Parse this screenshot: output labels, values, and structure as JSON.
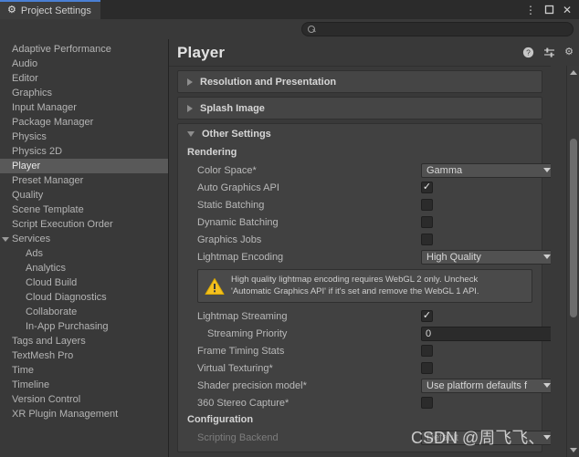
{
  "window": {
    "tab_label": "Project Settings",
    "tab_icon": "gear-icon",
    "controls": {
      "menu": "⋮",
      "maximize": "maximize-icon",
      "close": "✕"
    },
    "accent_color": "#4a7fd4"
  },
  "search": {
    "value": "",
    "placeholder": "",
    "icon": "search-icon"
  },
  "sidebar": {
    "items": [
      {
        "label": "Adaptive Performance",
        "level": 0,
        "selected": false,
        "expandable": false
      },
      {
        "label": "Audio",
        "level": 0,
        "selected": false,
        "expandable": false
      },
      {
        "label": "Editor",
        "level": 0,
        "selected": false,
        "expandable": false
      },
      {
        "label": "Graphics",
        "level": 0,
        "selected": false,
        "expandable": false
      },
      {
        "label": "Input Manager",
        "level": 0,
        "selected": false,
        "expandable": false
      },
      {
        "label": "Package Manager",
        "level": 0,
        "selected": false,
        "expandable": false
      },
      {
        "label": "Physics",
        "level": 0,
        "selected": false,
        "expandable": false
      },
      {
        "label": "Physics 2D",
        "level": 0,
        "selected": false,
        "expandable": false
      },
      {
        "label": "Player",
        "level": 0,
        "selected": true,
        "expandable": false
      },
      {
        "label": "Preset Manager",
        "level": 0,
        "selected": false,
        "expandable": false
      },
      {
        "label": "Quality",
        "level": 0,
        "selected": false,
        "expandable": false
      },
      {
        "label": "Scene Template",
        "level": 0,
        "selected": false,
        "expandable": false
      },
      {
        "label": "Script Execution Order",
        "level": 0,
        "selected": false,
        "expandable": false
      },
      {
        "label": "Services",
        "level": 0,
        "selected": false,
        "expandable": true
      },
      {
        "label": "Ads",
        "level": 1,
        "selected": false,
        "expandable": false
      },
      {
        "label": "Analytics",
        "level": 1,
        "selected": false,
        "expandable": false
      },
      {
        "label": "Cloud Build",
        "level": 1,
        "selected": false,
        "expandable": false
      },
      {
        "label": "Cloud Diagnostics",
        "level": 1,
        "selected": false,
        "expandable": false
      },
      {
        "label": "Collaborate",
        "level": 1,
        "selected": false,
        "expandable": false
      },
      {
        "label": "In-App Purchasing",
        "level": 1,
        "selected": false,
        "expandable": false
      },
      {
        "label": "Tags and Layers",
        "level": 0,
        "selected": false,
        "expandable": false
      },
      {
        "label": "TextMesh Pro",
        "level": 0,
        "selected": false,
        "expandable": false
      },
      {
        "label": "Time",
        "level": 0,
        "selected": false,
        "expandable": false
      },
      {
        "label": "Timeline",
        "level": 0,
        "selected": false,
        "expandable": false
      },
      {
        "label": "Version Control",
        "level": 0,
        "selected": false,
        "expandable": false
      },
      {
        "label": "XR Plugin Management",
        "level": 0,
        "selected": false,
        "expandable": false
      }
    ]
  },
  "main": {
    "title": "Player",
    "header_icons": [
      "help-icon",
      "preset-icon",
      "gear-icon"
    ],
    "foldouts": [
      {
        "label": "Resolution and Presentation",
        "expanded": false
      },
      {
        "label": "Splash Image",
        "expanded": false
      },
      {
        "label": "Other Settings",
        "expanded": true
      }
    ],
    "other_settings": {
      "rendering_label": "Rendering",
      "rows": [
        {
          "label": "Color Space*",
          "type": "dropdown",
          "value": "Gamma",
          "indent": 0,
          "disabled": false
        },
        {
          "label": "Auto Graphics API",
          "type": "checkbox",
          "value": true,
          "indent": 0,
          "disabled": false
        },
        {
          "label": "Static Batching",
          "type": "checkbox",
          "value": false,
          "indent": 0,
          "disabled": false
        },
        {
          "label": "Dynamic Batching",
          "type": "checkbox",
          "value": false,
          "indent": 0,
          "disabled": false
        },
        {
          "label": "Graphics Jobs",
          "type": "checkbox",
          "value": false,
          "indent": 0,
          "disabled": false
        },
        {
          "label": "Lightmap Encoding",
          "type": "dropdown",
          "value": "High Quality",
          "indent": 0,
          "disabled": false
        }
      ],
      "warning": {
        "icon": "warning-icon",
        "line1": "High quality lightmap encoding requires WebGL 2 only. Uncheck",
        "line2": "'Automatic Graphics API' if it's set and remove the WebGL 1 API."
      },
      "rows_after": [
        {
          "label": "Lightmap Streaming",
          "type": "checkbox",
          "value": true,
          "indent": 0,
          "disabled": false
        },
        {
          "label": "Streaming Priority",
          "type": "text",
          "value": "0",
          "indent": 1,
          "disabled": false
        },
        {
          "label": "Frame Timing Stats",
          "type": "checkbox",
          "value": false,
          "indent": 0,
          "disabled": false
        },
        {
          "label": "Virtual Texturing*",
          "type": "checkbox",
          "value": false,
          "indent": 0,
          "disabled": false
        },
        {
          "label": "Shader precision model*",
          "type": "dropdown",
          "value": "Use platform defaults f",
          "indent": 0,
          "disabled": false
        },
        {
          "label": "360 Stereo Capture*",
          "type": "checkbox",
          "value": false,
          "indent": 0,
          "disabled": false
        }
      ],
      "configuration_label": "Configuration",
      "config_rows": [
        {
          "label": "Scripting Backend",
          "type": "dropdown",
          "value": "Default",
          "indent": 0,
          "disabled": true
        }
      ]
    }
  },
  "scrollbar": {
    "up": "scroll-up-arrow",
    "down": "scroll-down-arrow"
  },
  "watermark": {
    "text": "CSDN @周飞飞、"
  }
}
